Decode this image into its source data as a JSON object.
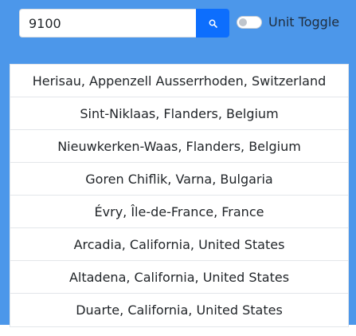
{
  "search": {
    "value": "9100",
    "button_icon": "search-icon"
  },
  "unit_toggle": {
    "label": "Unit Toggle",
    "checked": false
  },
  "results": [
    "Herisau, Appenzell Ausserrhoden, Switzerland",
    "Sint-Niklaas, Flanders, Belgium",
    "Nieuwkerken-Waas, Flanders, Belgium",
    "Goren Chiflik, Varna, Bulgaria",
    "Évry, Île-de-France, France",
    "Arcadia, California, United States",
    "Altadena, California, United States",
    "Duarte, California, United States"
  ],
  "colors": {
    "header_background": "#4c97ea",
    "search_button": "#0d6efd",
    "text": "#212529"
  }
}
